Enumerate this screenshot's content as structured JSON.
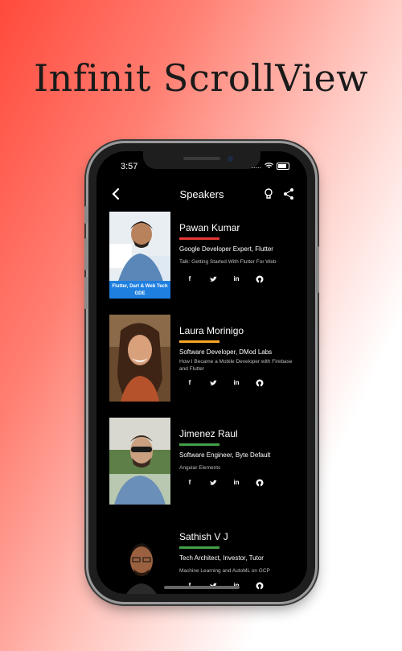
{
  "headline": "Infinit ScrollView",
  "status": {
    "time": "3:57",
    "signal": "....."
  },
  "appbar": {
    "title": "Speakers"
  },
  "icons": {
    "back": "back-arrow-icon",
    "idea": "lightbulb-icon",
    "share": "share-icon",
    "socials": [
      "facebook-icon",
      "twitter-icon",
      "linkedin-icon",
      "github-icon"
    ]
  },
  "speakers": [
    {
      "name": "Pawan Kumar",
      "role": "Google Developer Expert, Flutter",
      "talk": "Talk: Getting Started With Flutter For Web",
      "badge": "Flutter, Dart & Web Tech GDE",
      "accent": "#e53935"
    },
    {
      "name": "Laura Morinigo",
      "role": "Software Developer, DMod Labs",
      "talk": "How I Became a Mobile Developer with Firebase and Flutter",
      "badge": "",
      "accent": "#f9a825"
    },
    {
      "name": "Jimenez Raul",
      "role": "Software Engineer, Byte Default",
      "talk": "Angular Elements",
      "badge": "",
      "accent": "#43a047"
    },
    {
      "name": "Sathish V J",
      "role": "Tech Architect, Investor, Tutor",
      "talk": "Machine Learning and AutoML on GCP",
      "badge": "",
      "accent": "#43a047"
    }
  ]
}
